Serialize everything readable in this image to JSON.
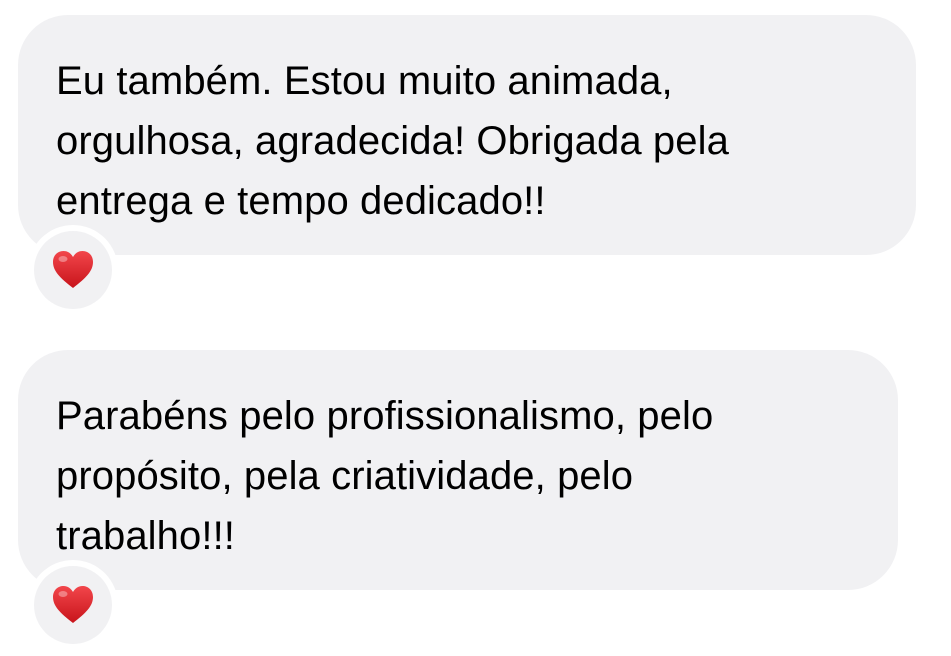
{
  "messages": [
    {
      "lines": [
        "Eu também. Estou muito animada,",
        "orgulhosa, agradecida! Obrigada pela",
        "entrega e tempo dedicado!!"
      ],
      "reaction": "heart-icon"
    },
    {
      "lines": [
        "Parabéns pelo profissionalismo, pelo",
        "propósito, pela criatividade, pelo",
        "trabalho!!!"
      ],
      "reaction": "heart-icon"
    }
  ],
  "colors": {
    "bubble": "#f1f1f3",
    "text": "#000000",
    "heart": "#e0242a"
  }
}
